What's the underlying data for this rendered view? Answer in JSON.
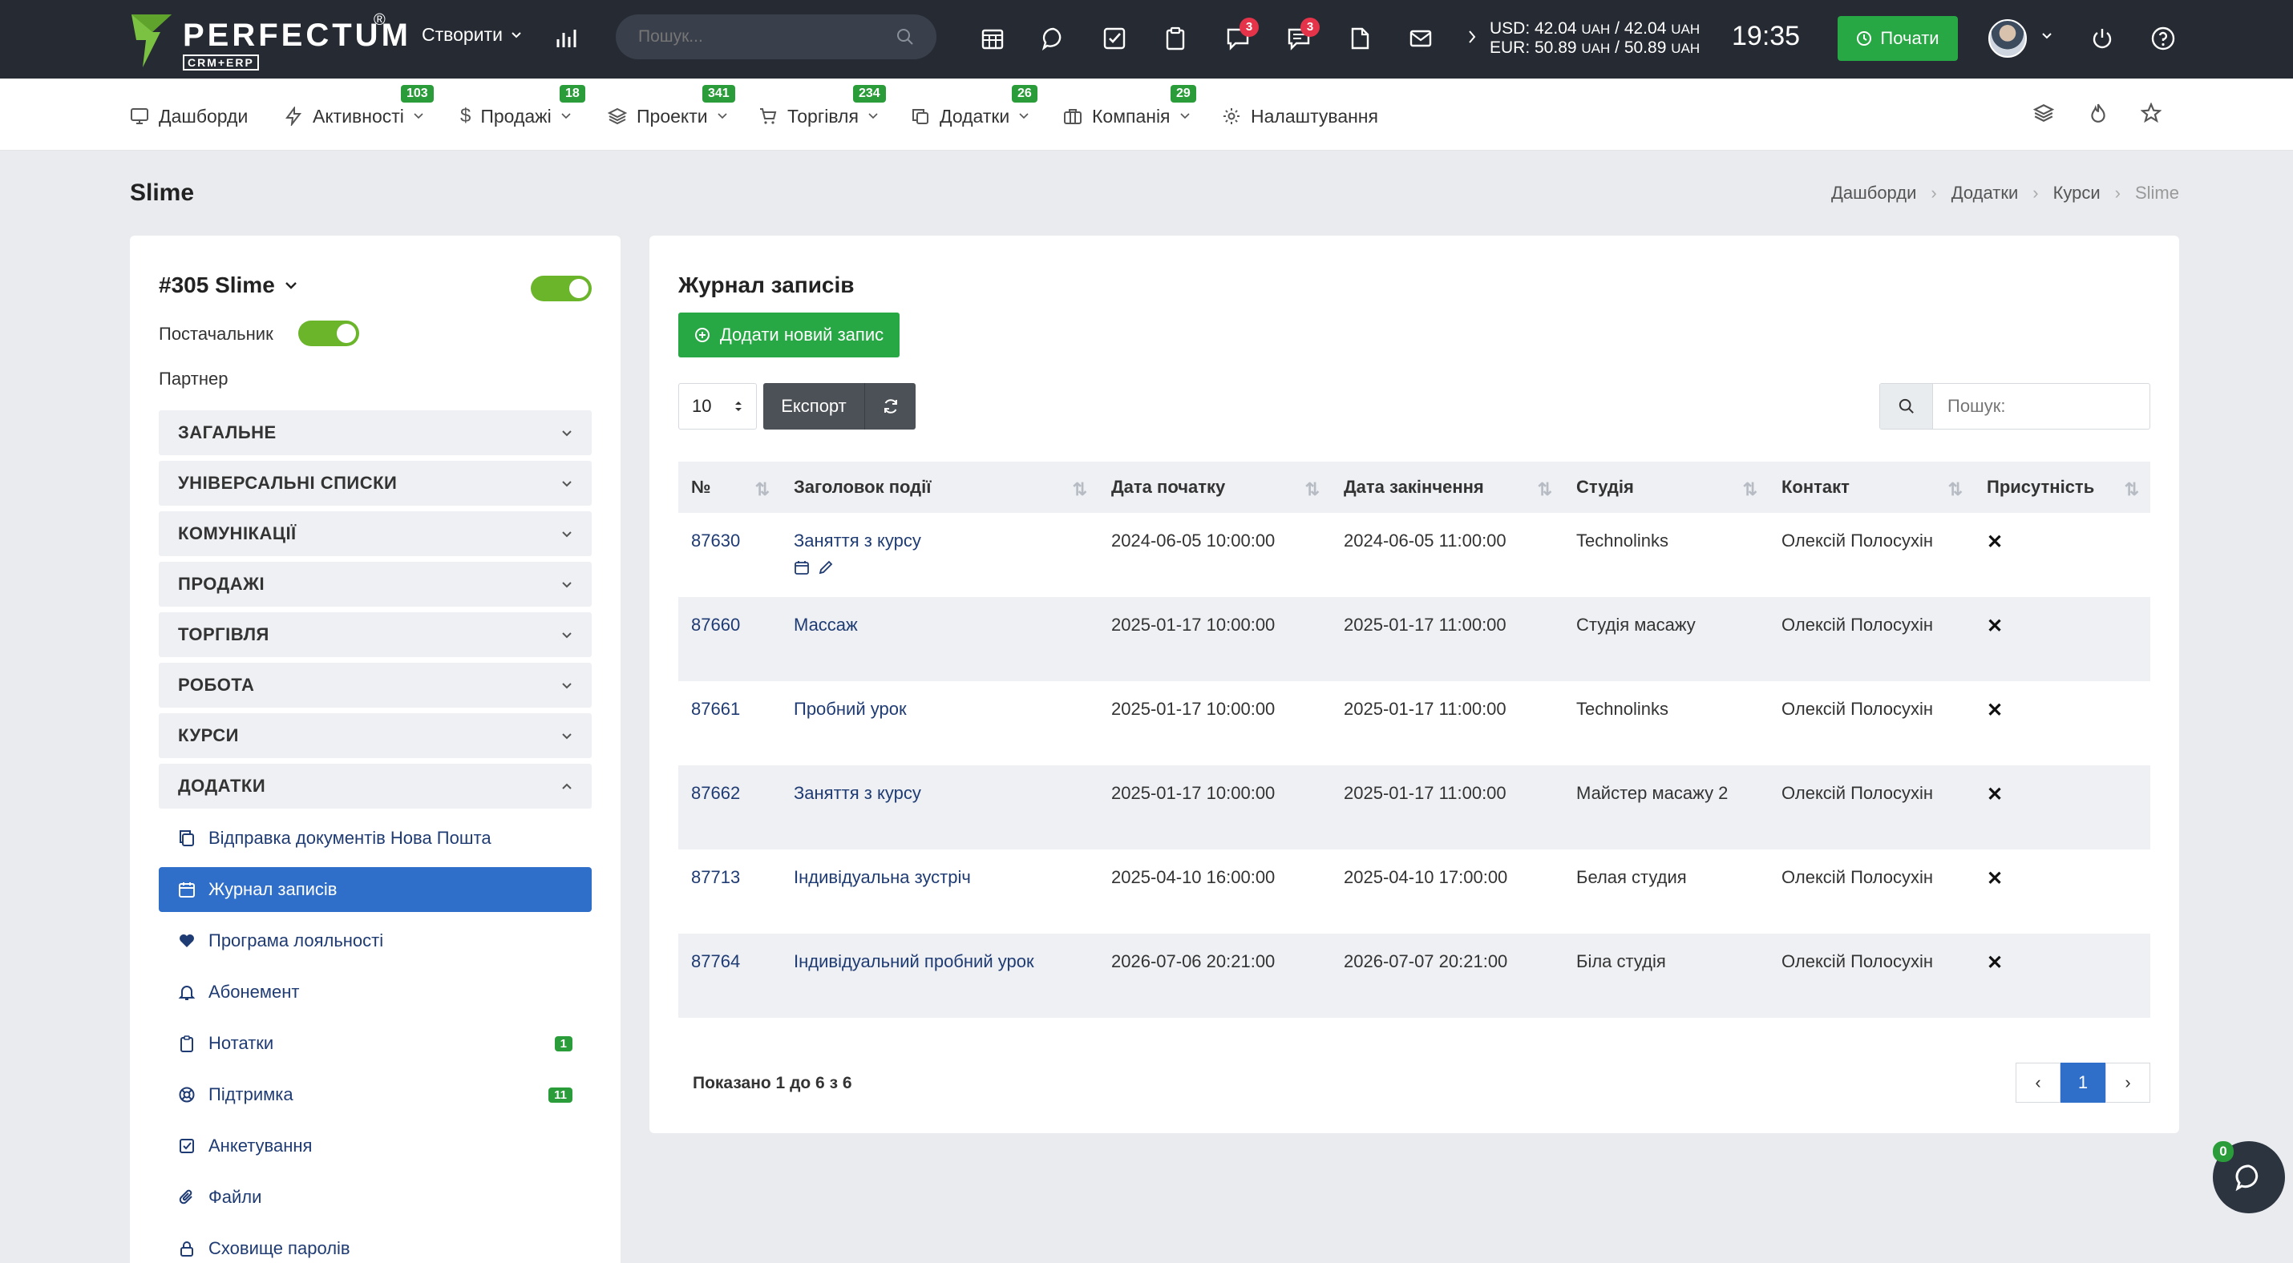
{
  "topbar": {
    "logo_word": "PERFECTUM",
    "logo_sub": "CRM+ERP",
    "logo_reg": "®",
    "create_label": "Створити",
    "search_placeholder": "Пошук...",
    "msg_badge_1": "3",
    "msg_badge_2": "3",
    "usd_line": "USD: 42.04",
    "usd_unit1": "UAH",
    "usd_mid": "/ 42.04",
    "usd_unit2": "UAH",
    "eur_line": "EUR: 50.89",
    "eur_unit1": "UAH",
    "eur_mid": "/ 50.89",
    "eur_unit2": "UAH",
    "clock": "19:35",
    "start_label": "Почати",
    "icons": [
      "calendar-icon",
      "chat-icon",
      "task-icon",
      "clipboard-icon",
      "messages-icon",
      "messages-alt-icon",
      "document-icon",
      "mail-icon",
      "power-icon",
      "help-icon"
    ]
  },
  "nav": {
    "items": [
      {
        "label": "Дашборди",
        "badge": ""
      },
      {
        "label": "Активності",
        "badge": "103"
      },
      {
        "label": "Продажі",
        "badge": "18"
      },
      {
        "label": "Проекти",
        "badge": "341"
      },
      {
        "label": "Торгівля",
        "badge": "234"
      },
      {
        "label": "Додатки",
        "badge": "26"
      },
      {
        "label": "Компанія",
        "badge": "29"
      },
      {
        "label": "Налаштування",
        "badge": ""
      }
    ]
  },
  "page": {
    "title": "Slime",
    "breadcrumb": [
      "Дашборди",
      "Додатки",
      "Курси",
      "Slime"
    ]
  },
  "left": {
    "entity_title": "#305 Slime",
    "supplier_label": "Постачальник",
    "partner_label": "Партнер",
    "sections": [
      "ЗАГАЛЬНЕ",
      "УНІВЕРСАЛЬНІ СПИСКИ",
      "КОМУНІКАЦІЇ",
      "ПРОДАЖІ",
      "ТОРГІВЛЯ",
      "РОБОТА",
      "КУРСИ",
      "ДОДАТКИ"
    ],
    "addons": [
      {
        "label": "Відправка документів Нова Пошта",
        "count": ""
      },
      {
        "label": "Журнал записів",
        "count": ""
      },
      {
        "label": "Програма лояльності",
        "count": ""
      },
      {
        "label": "Абонемент",
        "count": ""
      },
      {
        "label": "Нотатки",
        "count": "1"
      },
      {
        "label": "Підтримка",
        "count": "11"
      },
      {
        "label": "Анкетування",
        "count": ""
      },
      {
        "label": "Файли",
        "count": ""
      },
      {
        "label": "Сховище паролів",
        "count": ""
      }
    ]
  },
  "journal": {
    "title": "Журнал записів",
    "add_label": "Додати новий запис",
    "per_page": "10",
    "export_label": "Експорт",
    "search_placeholder": "Пошук:",
    "columns": [
      "№",
      "Заголовок події",
      "Дата початку",
      "Дата закінчення",
      "Студія",
      "Контакт",
      "Присутність"
    ],
    "rows": [
      {
        "id": "87630",
        "title": "Заняття з курсу",
        "start": "2024-06-05 10:00:00",
        "end": "2024-06-05 11:00:00",
        "studio": "Technolinks",
        "contact": "Олексій Полосухін",
        "presence": "✕"
      },
      {
        "id": "87660",
        "title": "Массаж",
        "start": "2025-01-17 10:00:00",
        "end": "2025-01-17 11:00:00",
        "studio": "Студія масажу",
        "contact": "Олексій Полосухін",
        "presence": "✕"
      },
      {
        "id": "87661",
        "title": "Пробний урок",
        "start": "2025-01-17 10:00:00",
        "end": "2025-01-17 11:00:00",
        "studio": "Technolinks",
        "contact": "Олексій Полосухін",
        "presence": "✕"
      },
      {
        "id": "87662",
        "title": "Заняття з курсу",
        "start": "2025-01-17 10:00:00",
        "end": "2025-01-17 11:00:00",
        "studio": "Майстер масажу 2",
        "contact": "Олексій Полосухін",
        "presence": "✕"
      },
      {
        "id": "87713",
        "title": "Індивідуальна зустріч",
        "start": "2025-04-10 16:00:00",
        "end": "2025-04-10 17:00:00",
        "studio": "Белая студия",
        "contact": "Олексій Полосухін",
        "presence": "✕"
      },
      {
        "id": "87764",
        "title": "Індивідуальний пробний урок",
        "start": "2026-07-06 20:21:00",
        "end": "2026-07-07 20:21:00",
        "studio": "Біла студія",
        "contact": "Олексій Полосухін",
        "presence": "✕"
      }
    ],
    "shown_text": "Показано 1 до 6 з 6",
    "page_prev": "‹",
    "page_current": "1",
    "page_next": "›"
  },
  "chat": {
    "badge": "0"
  },
  "colors": {
    "topbar": "#252a33",
    "green": "#28a745",
    "blue": "#2f6ec9",
    "link": "#1f3b73",
    "badge_red": "#e5344a"
  }
}
